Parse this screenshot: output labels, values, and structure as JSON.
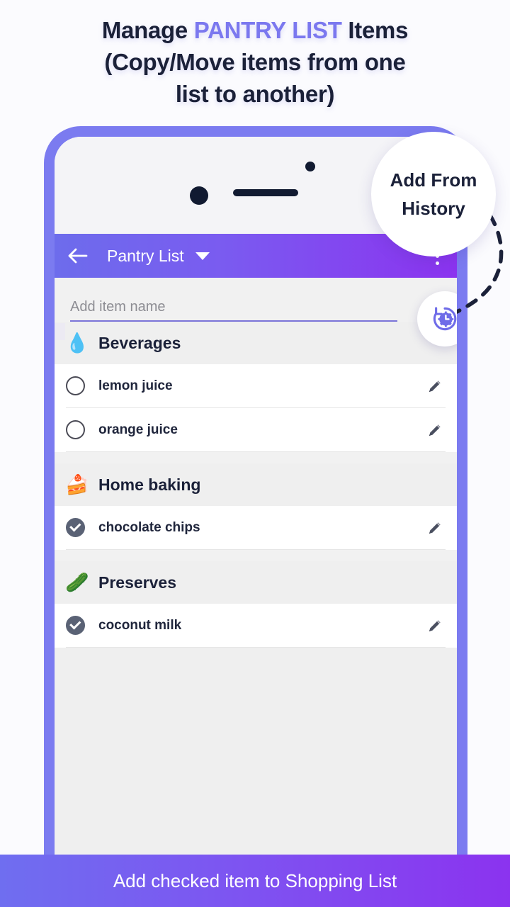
{
  "headline": {
    "line1_pre": "Manage ",
    "line1_accent": "PANTRY LIST",
    "line1_post": " Items",
    "line2": "(Copy/Move items from one",
    "line3": "list to another)"
  },
  "appbar": {
    "back_icon": "back-arrow-icon",
    "title": "Pantry List",
    "dropdown_icon": "chevron-down-icon",
    "overflow_icon": "kebab-menu-icon"
  },
  "input": {
    "placeholder": "Add item name",
    "value": ""
  },
  "fab": {
    "icon": "history-restore-icon",
    "label": "Add From History"
  },
  "callout": {
    "line1": "Add From",
    "line2": "History"
  },
  "sections": [
    {
      "icon": "💧",
      "icon_name": "water-droplet-icon",
      "title": "Beverages",
      "items": [
        {
          "name": "lemon juice",
          "checked": false
        },
        {
          "name": "orange juice",
          "checked": false
        }
      ]
    },
    {
      "icon": "🍰",
      "icon_name": "cake-slice-icon",
      "title": "Home baking",
      "items": [
        {
          "name": "chocolate chips",
          "checked": true
        }
      ]
    },
    {
      "icon": "🥒",
      "icon_name": "pickle-jar-icon",
      "title": "Preserves",
      "items": [
        {
          "name": "coconut milk",
          "checked": true
        }
      ]
    }
  ],
  "bottom_banner": {
    "text": "Add checked item to Shopping List"
  },
  "colors": {
    "accent_purple": "#7b78ef",
    "appbar_start": "#6d6cec",
    "appbar_end": "#8b33ef",
    "frame": "#7b7bf0",
    "heading_dark": "#1b2139",
    "checked_gray": "#5a6275"
  }
}
